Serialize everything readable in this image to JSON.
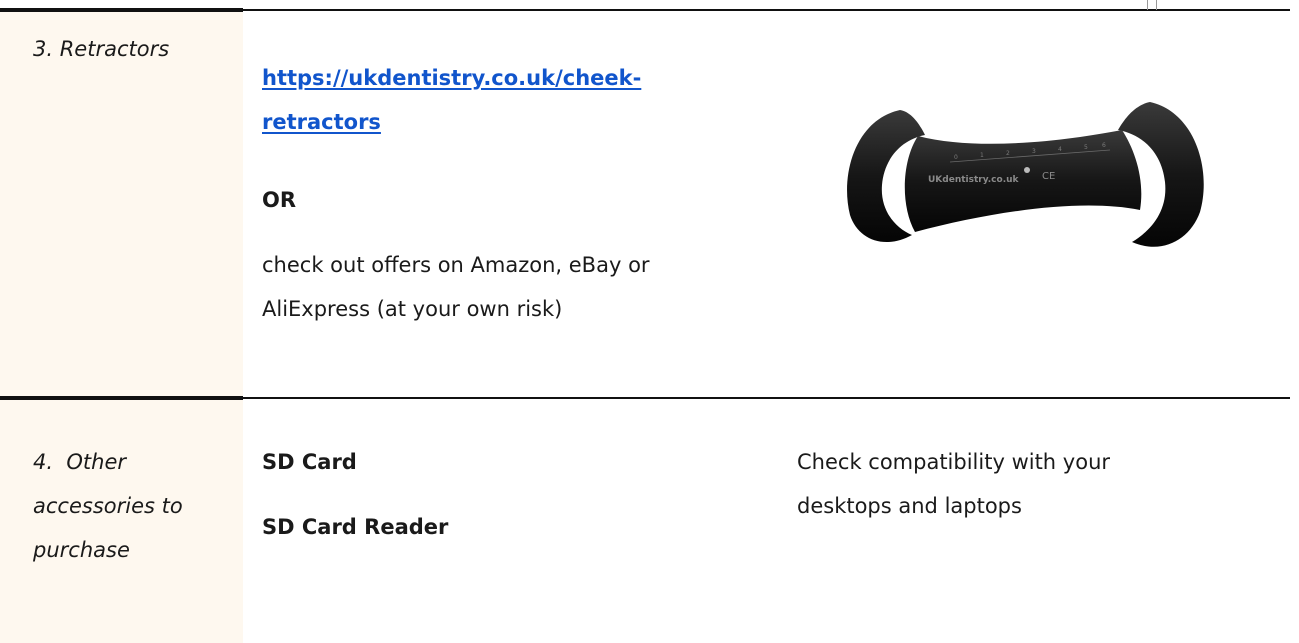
{
  "rows": [
    {
      "label": "3. Retractors",
      "link_line1": "https://ukdentistry.co.uk/cheek-",
      "link_line2": "retractors",
      "or_text": "OR",
      "note_line1": "check out offers on Amazon, eBay or",
      "note_line2": "AliExpress (at your own risk)",
      "image": {
        "name": "cheek-retractor-image",
        "brand_text": "UKdentistry.co.uk",
        "mark_text": "CE",
        "scale_numbers": [
          "0",
          "1",
          "2",
          "3",
          "4",
          "5",
          "6"
        ],
        "color": "#161616"
      }
    },
    {
      "label_lines": [
        "4.  Other",
        "accessories to",
        "purchase"
      ],
      "items": [
        "SD Card",
        "SD Card Reader"
      ],
      "note_lines": [
        "Check compatibility with your",
        "desktops and laptops"
      ]
    }
  ],
  "colors": {
    "label_bg": "#fef8ef",
    "link": "#1155cc",
    "rule": "#111111"
  }
}
